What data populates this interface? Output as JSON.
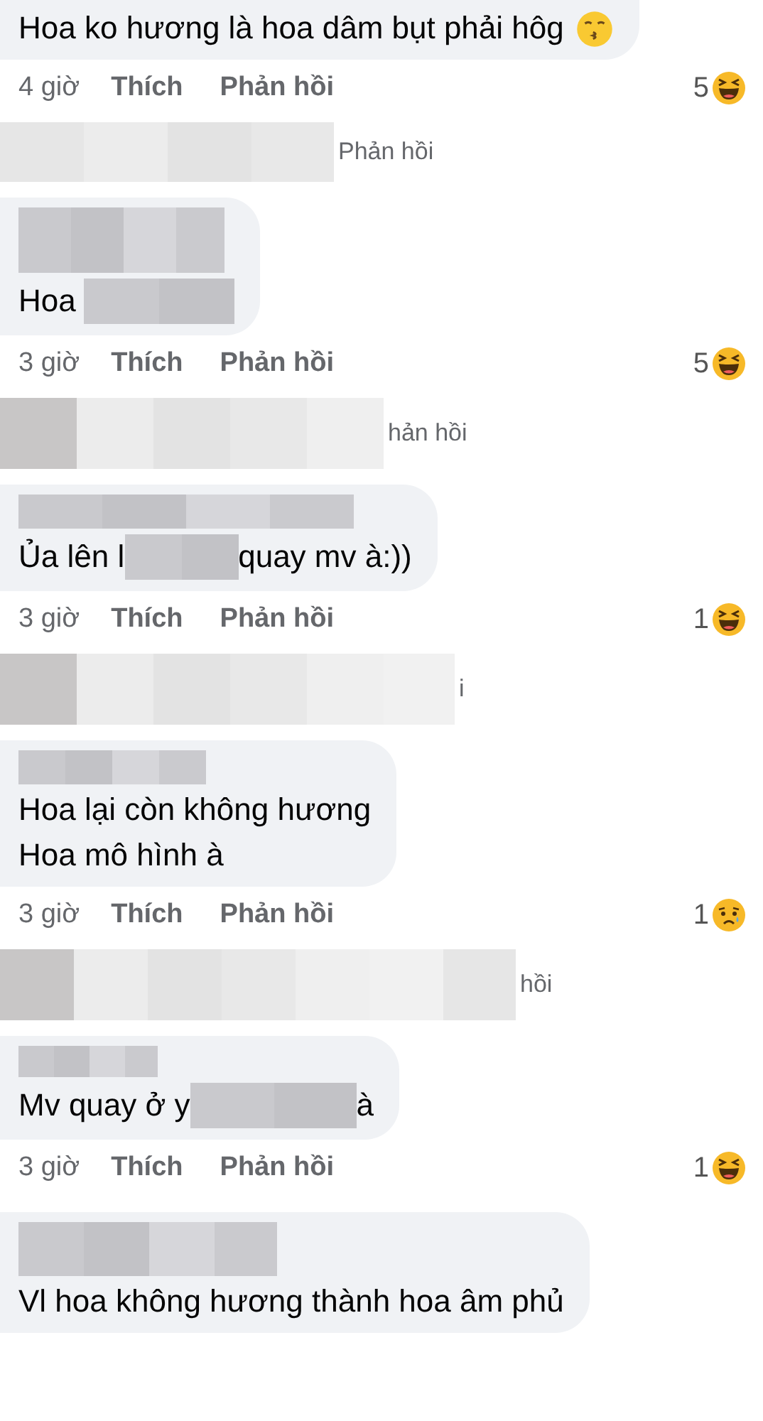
{
  "comments": [
    {
      "lines": [
        [
          {
            "kind": "text",
            "text": "Hoa ko hương là hoa dâm bụt phải hôg "
          },
          {
            "kind": "emoji"
          }
        ]
      ],
      "time": "4 giờ",
      "like": "Thích",
      "reply": "Phản hồi",
      "reaction": {
        "count": "5",
        "kind": "haha"
      },
      "reply_link": "Phản hồi"
    },
    {
      "lines": [
        [
          {
            "kind": "text",
            "text": "Hoa "
          },
          {
            "kind": "redacted"
          }
        ]
      ],
      "time": "3 giờ",
      "like": "Thích",
      "reply": "Phản hồi",
      "reaction": {
        "count": "5",
        "kind": "haha"
      },
      "reply_link": "hản hồi"
    },
    {
      "lines": [
        [
          {
            "kind": "text",
            "text": "Ủa lên l"
          },
          {
            "kind": "redacted"
          },
          {
            "kind": "text",
            "text": "quay mv à:))"
          }
        ]
      ],
      "time": "3 giờ",
      "like": "Thích",
      "reply": "Phản hồi",
      "reaction": {
        "count": "1",
        "kind": "haha"
      },
      "reply_link": "i"
    },
    {
      "lines": [
        [
          {
            "kind": "text",
            "text": "Hoa lại còn không hương"
          }
        ],
        [
          {
            "kind": "text",
            "text": "Hoa mô hình à"
          }
        ]
      ],
      "time": "3 giờ",
      "like": "Thích",
      "reply": "Phản hồi",
      "reaction": {
        "count": "1",
        "kind": "sad"
      },
      "reply_link": "hồi"
    },
    {
      "lines": [
        [
          {
            "kind": "text",
            "text": "Mv quay ở y"
          },
          {
            "kind": "redacted"
          },
          {
            "kind": "text",
            "text": "à"
          }
        ]
      ],
      "time": "3 giờ",
      "like": "Thích",
      "reply": "Phản hồi",
      "reaction": {
        "count": "1",
        "kind": "haha"
      }
    },
    {
      "lines": [
        [
          {
            "kind": "text",
            "text": "Vl hoa không hương thành hoa âm phủ"
          }
        ]
      ]
    }
  ]
}
